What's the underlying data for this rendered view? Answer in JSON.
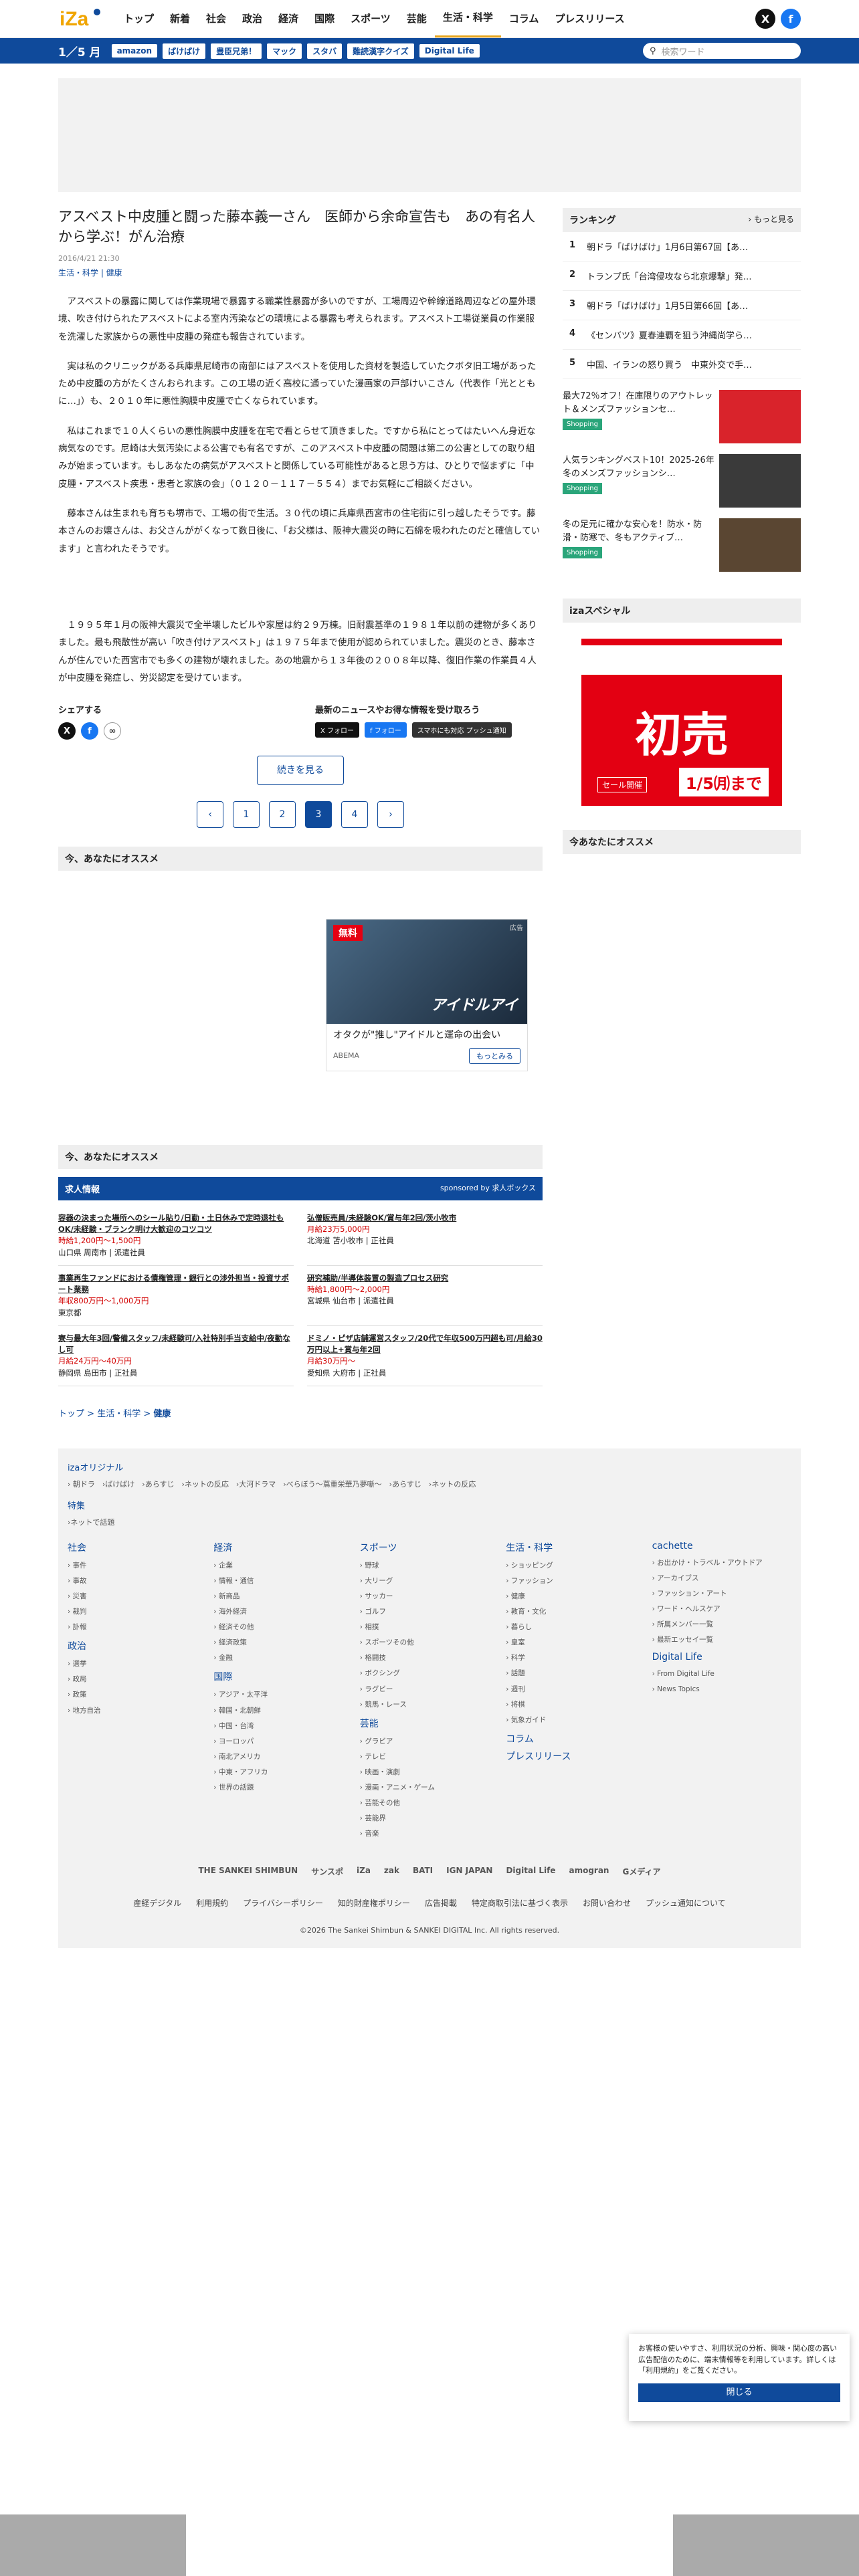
{
  "header": {
    "logo_text": "iZa",
    "nav": [
      "トップ",
      "新着",
      "社会",
      "政治",
      "経済",
      "国際",
      "スポーツ",
      "芸能",
      "生活・科学",
      "コラム",
      "プレスリリース"
    ],
    "active_nav": "生活・科学",
    "social": [
      "X",
      "f"
    ]
  },
  "bluebar": {
    "date": "1／5 月",
    "tags": [
      "amazon",
      "ばけばけ",
      "豊臣兄弟！",
      "マック",
      "スタバ",
      "難読漢字クイズ",
      "Digital Life"
    ],
    "search_placeholder": "検索ワード"
  },
  "article": {
    "title": "アスベスト中皮腫と闘った藤本義一さん　医師から余命宣告も　あの有名人から学ぶ！がん治療",
    "date": "2016/4/21 21:30",
    "category": "生活・科学 | 健康",
    "paragraphs": [
      "アスベストの暴露に関しては作業現場で暴露する職業性暴露が多いのですが、工場周辺や幹線道路周辺などの屋外環境、吹き付けられたアスベストによる室内汚染などの環境による暴露も考えられます。アスベスト工場従業員の作業服を洗濯した家族からの悪性中皮腫の発症も報告されています。",
      "実は私のクリニックがある兵庫県尼崎市の南部にはアスベストを使用した資材を製造していたクボタ旧工場があったため中皮腫の方がたくさんおられます。この工場の近く高校に通っていた漫画家の戸部けいこさん（代表作「光とともに…」）も、２０１０年に悪性胸膜中皮腫で亡くなられています。",
      "私はこれまで１０人くらいの悪性胸膜中皮腫を在宅で看とらせて頂きました。ですから私にとってはたいへん身近な病気なのです。尼崎は大気汚染による公害でも有名ですが、このアスベスト中皮腫の問題は第二の公害としての取り組みが始まっています。もしあなたの病気がアスベストと関係している可能性があると思う方は、ひとりで悩まずに「中皮腫・アスベスト疾患・患者と家族の会」（０１２０－１１７－５５４）までお気軽にご相談ください。",
      "藤本さんは生まれも育ちも堺市で、工場の街で生活。３０代の頃に兵庫県西宮市の住宅街に引っ越したそうです。藤本さんのお嬢さんは、お父さんががくなって数日後に、「お父様は、阪神大震災の時に石綿を吸われたのだと確信しています」と言われたそうです。",
      "１９９５年１月の阪神大震災で全半壊したビルや家屋は約２９万棟。旧耐震基準の１９８１年以前の建物が多くありました。最も飛散性が高い「吹き付けアスベスト」は１９７５年まで使用が認められていました。震災のとき、藤本さんが住んでいた西宮市でも多くの建物が壊れました。あの地震から１３年後の２００８年以降、復旧作業の作業員４人が中皮腫を発症し、労災認定を受けています。"
    ]
  },
  "share": {
    "label": "シェアする",
    "follow_label": "最新のニュースやお得な情報を受け取ろう",
    "follow_buttons": [
      "X フォロー",
      "f フォロー",
      "スマホにも対応 プッシュ通知"
    ]
  },
  "more_button": "続きを見る",
  "pager": [
    "‹",
    "1",
    "2",
    "3",
    "4",
    "›"
  ],
  "current_page": "3",
  "reco_heading": "今、あなたにオススメ",
  "reco_card": {
    "badge": "無料",
    "image_text": "アイドルアイ",
    "title": "オタクが\"推し\"アイドルと運命の出会い",
    "source": "ABEMA",
    "button": "もっとみる",
    "ad_label": "広告"
  },
  "jobs": {
    "heading": "今、あなたにオススメ",
    "bar_title": "求人情報",
    "sponsor": "sponsored by 求人ボックス",
    "items": [
      {
        "title": "容器の決まった場所へのシール貼り/日勤・土日休みで定時退社もOK/未経験・ブランク明け大歓迎のコツコツ",
        "salary": "時給1,200円〜1,500円",
        "place": "山口県 周南市 | 派遣社員"
      },
      {
        "title": "弘僧販売員/未経験OK/賞与年2回/茨小牧市",
        "salary": "月給23万5,000円",
        "place": "北海道 苫小牧市 | 正社員"
      },
      {
        "title": "事業再生ファンドにおける債権管理・銀行との渉外担当・投資サポート業務",
        "salary": "年収800万円〜1,000万円",
        "place": "東京都"
      },
      {
        "title": "研究補助/半導体装置の製造プロセス研究",
        "salary": "時給1,800円〜2,000円",
        "place": "宮城県 仙台市 | 派遣社員"
      },
      {
        "title": "寮与最大年3回/警備スタッフ/未経験可/入社特別手当支給中/夜勤なし可",
        "salary": "月給24万円〜40万円",
        "place": "静岡県 島田市 | 正社員"
      },
      {
        "title": "ドミノ・ピザ店舗運営スタッフ/20代で年収500万円超も可/月給30万円以上+賞与年2回",
        "salary": "月給30万円〜",
        "place": "愛知県 大府市 | 正社員"
      }
    ]
  },
  "breadcrumb": [
    "トップ",
    "生活・科学",
    "健康"
  ],
  "sidebar": {
    "ranking_title": "ランキング",
    "ranking_more": "もっと見る",
    "ranking": [
      "朝ドラ「ばけばけ」1月6日第67回【あ…",
      "トランプ氏「台湾侵攻なら北京爆撃」発…",
      "朝ドラ「ばけばけ」1月5日第66回【あ…",
      "《センバツ》夏春連覇を狙う沖縄尚学ら…",
      "中国、イランの怒り買う　中東外交で手…"
    ],
    "promos": [
      {
        "text": "最大72％オフ！在庫限りのアウトレット＆メンズファッションセ…",
        "tag": "Shopping"
      },
      {
        "text": "人気ランキングベスト10！2025-26年冬のメンズファッションシ…",
        "tag": "Shopping"
      },
      {
        "text": "冬の足元に確かな安心を！防水・防滑・防寒で、冬もアクティブ…",
        "tag": "Shopping"
      }
    ],
    "special_title": "izaスペシャル",
    "sale_label": "初売",
    "sale_date": "1/5㈪まで",
    "sale_sub": "セール開催",
    "reco_title": "今あなたにオススメ"
  },
  "footer": {
    "original_title": "izaオリジナル",
    "original_links": "朝ドラ　›ばけばけ　›あらすじ　›ネットの反応　›大河ドラマ　›べらぼう〜蔦重栄華乃夢噺〜　›あらすじ　›ネットの反応",
    "special_title": "特集",
    "special_links": "›ネットで話題",
    "columns": [
      {
        "head": "社会",
        "links": [
          "事件",
          "事故",
          "災害",
          "裁判",
          "訃報"
        ],
        "head2": "政治",
        "links2": [
          "選挙",
          "政局",
          "政策",
          "地方自治"
        ]
      },
      {
        "head": "経済",
        "links": [
          "企業",
          "情報・通信",
          "新商品",
          "海外経済",
          "経済その他",
          "経済政策",
          "金融"
        ],
        "head2": "国際",
        "links2": [
          "アジア・太平洋",
          "韓国・北朝鮮",
          "中国・台湾",
          "ヨーロッパ",
          "南北アメリカ",
          "中東・アフリカ",
          "世界の話題"
        ]
      },
      {
        "head": "スポーツ",
        "links": [
          "野球",
          "大リーグ",
          "サッカー",
          "ゴルフ",
          "相撲",
          "スポーツその他",
          "格闘技",
          "ボクシング",
          "ラグビー",
          "競馬・レース"
        ],
        "head2": "芸能",
        "links2": [
          "グラビア",
          "テレビ",
          "映画・演劇",
          "漫画・アニメ・ゲーム",
          "芸能その他",
          "芸能界",
          "音楽"
        ]
      },
      {
        "head": "生活・科学",
        "links": [
          "ショッピング",
          "ファッション",
          "健康",
          "教育・文化",
          "暮らし",
          "皇室",
          "科学",
          "話題",
          "週刊",
          "将棋",
          "気象ガイド"
        ],
        "head2": "コラム",
        "links2": [],
        "head3": "プレスリリース"
      },
      {
        "head": "cachette",
        "links": [
          "お出かけ・トラベル・アウトドア",
          "アーカイブス",
          "ファッション・アート",
          "ワード・ヘルスケア",
          "所属メンバー一覧",
          "最新エッセイ一覧"
        ],
        "head2": "Digital Life",
        "links2": [
          "From Digital Life",
          "News Topics"
        ]
      }
    ],
    "logos": [
      "THE SANKEI SHIMBUN",
      "サンスポ",
      "iZa",
      "zak",
      "BATI",
      "IGN JAPAN",
      "Digital Life",
      "amogran",
      "Gメディア"
    ],
    "links": [
      "産経デジタル",
      "利用規約",
      "プライバシーポリシー",
      "知的財産権ポリシー",
      "広告掲載",
      "特定商取引法に基づく表示",
      "お問い合わせ",
      "プッシュ通知について"
    ],
    "copyright": "©2026 The Sankei Shimbun & SANKEI DIGITAL Inc. All rights reserved."
  },
  "cookie": {
    "text": "お客様の使いやすさ、利用状況の分析、興味・関心度の高い広告配信のために、端末情報等を利用しています。詳しくは「利用規約」をご覧ください。",
    "button": "閉じる"
  },
  "colors": {
    "brand_blue": "#0f4a9b",
    "accent": "#e7a41a",
    "sale_red": "#e30012"
  }
}
